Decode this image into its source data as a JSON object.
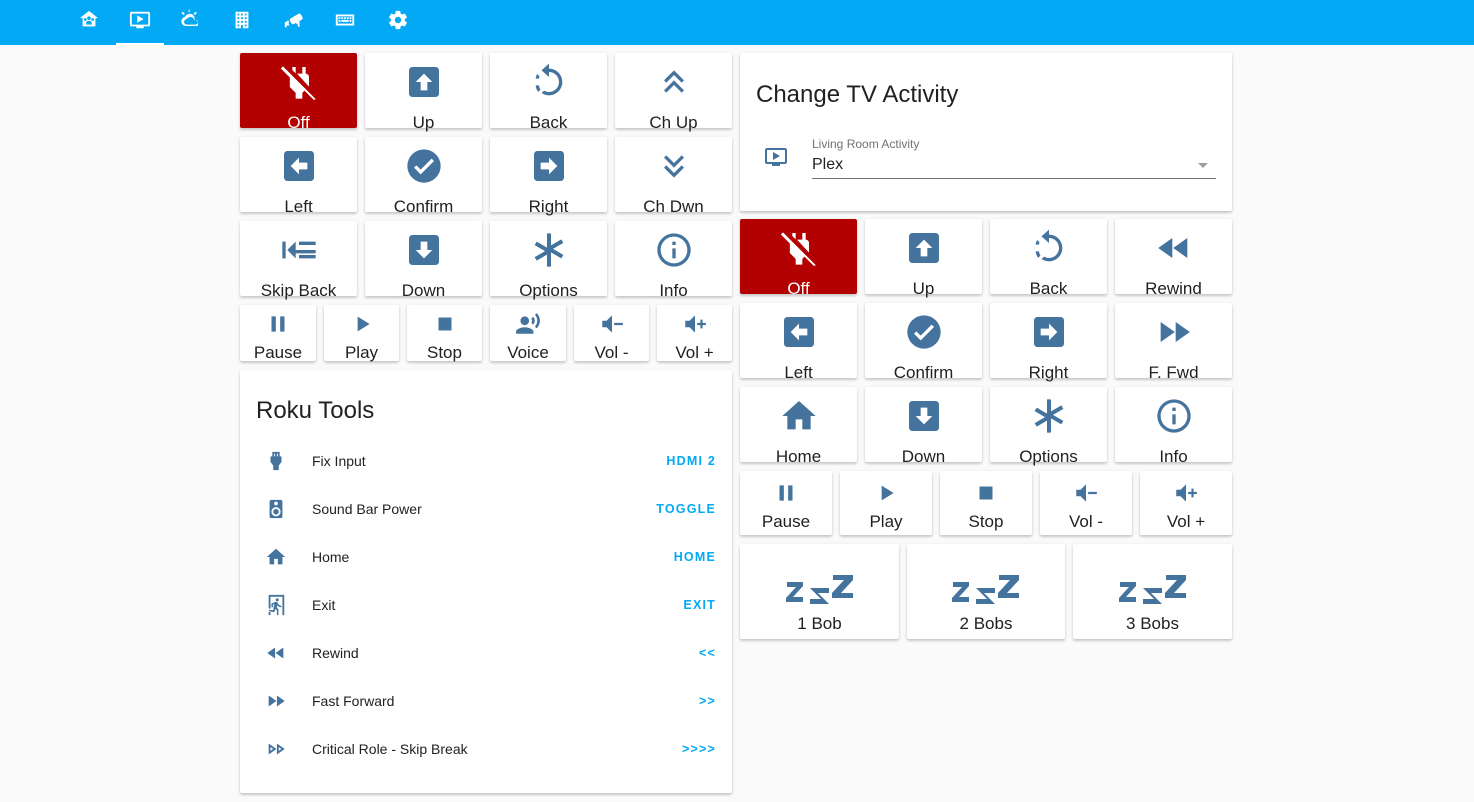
{
  "nav_tabs": [
    {
      "icon": "home-group-icon"
    },
    {
      "icon": "television-play-icon"
    },
    {
      "icon": "weather-icon"
    },
    {
      "icon": "office-building-icon"
    },
    {
      "icon": "cctv-icon"
    },
    {
      "icon": "remote-keyboard-icon"
    },
    {
      "icon": "gear-icon"
    }
  ],
  "active_tab": "television-play-icon",
  "colors": {
    "header": "#03a9f4",
    "icon": "#44739e",
    "off": "#b30000",
    "action": "#03a9f4"
  },
  "left_remote": {
    "off": "Off",
    "up": "Up",
    "back": "Back",
    "ch_up": "Ch Up",
    "left": "Left",
    "confirm": "Confirm",
    "right": "Right",
    "ch_down": "Ch Dwn",
    "skip_back": "Skip Back",
    "down": "Down",
    "options": "Options",
    "info": "Info",
    "pause": "Pause",
    "play": "Play",
    "stop": "Stop",
    "voice": "Voice",
    "vol_down": "Vol -",
    "vol_up": "Vol +"
  },
  "roku_tools": {
    "title": "Roku Tools",
    "rows": [
      {
        "name": "Fix Input",
        "action": "HDMI 2",
        "icon": "hdmi-port-icon"
      },
      {
        "name": "Sound Bar Power",
        "action": "TOGGLE",
        "icon": "speaker-icon"
      },
      {
        "name": "Home",
        "action": "HOME",
        "icon": "home-icon"
      },
      {
        "name": "Exit",
        "action": "EXIT",
        "icon": "exit-run-icon"
      },
      {
        "name": "Rewind",
        "action": "<<",
        "icon": "rewind-icon"
      },
      {
        "name": "Fast Forward",
        "action": ">>",
        "icon": "fast-forward-icon"
      },
      {
        "name": "Critical Role - Skip Break",
        "action": ">>>>",
        "icon": "fast-forward-outline-icon"
      }
    ]
  },
  "activity": {
    "title": "Change TV Activity",
    "select_label": "Living Room Activity",
    "select_value": "Plex",
    "icon": "television-play-icon"
  },
  "right_remote": {
    "off": "Off",
    "up": "Up",
    "back": "Back",
    "rewind": "Rewind",
    "left": "Left",
    "confirm": "Confirm",
    "right": "Right",
    "ffwd": "F. Fwd",
    "home": "Home",
    "down": "Down",
    "options": "Options",
    "info": "Info",
    "pause": "Pause",
    "play": "Play",
    "stop": "Stop",
    "vol_down": "Vol -",
    "vol_up": "Vol +"
  },
  "sleep": {
    "one": "1 Bob",
    "two": "2 Bobs",
    "three": "3 Bobs"
  }
}
